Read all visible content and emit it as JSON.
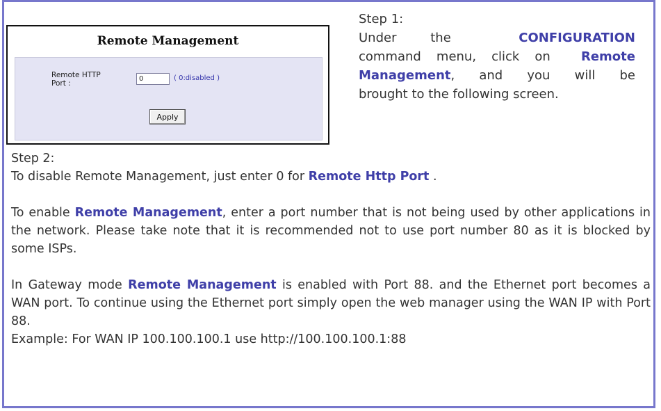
{
  "screenshot": {
    "title": "Remote Management",
    "port_label": "Remote HTTP Port :",
    "port_value": "0",
    "port_hint": "( 0:disabled )",
    "apply_label": "Apply"
  },
  "step1": {
    "heading": "Step 1:",
    "line1_a": "Under the",
    "line1_b": "CONFIGURATION",
    "line2_a": "command menu, click on",
    "line2_b": "Remote",
    "line3_a": "Management",
    "line3_b": ", and you will be",
    "line4": "brought to the following screen."
  },
  "step2": {
    "heading": "Step 2:",
    "disable_a": "To disable Remote Management, just enter  0 for ",
    "disable_b": "Remote Http Port",
    "disable_c": " .",
    "enable_a": "To enable ",
    "enable_b": "Remote Management",
    "enable_c": ", enter a port number that is not being used by other applications in the network. Please take note that it is recommended not to use port number 80 as it is blocked by some ISPs.",
    "gateway_a": "In Gateway mode ",
    "gateway_b": "Remote Management",
    "gateway_c": " is enabled with Port 88. and the Ethernet port becomes a WAN port. To continue using the Ethernet port simply open the web manager using the WAN IP with Port 88.",
    "example": "Example: For WAN IP 100.100.100.1 use http://100.100.100.1:88"
  },
  "colors": {
    "frame": "#7777cc",
    "highlight": "#3f3fa8",
    "panel": "#e4e4f4"
  }
}
